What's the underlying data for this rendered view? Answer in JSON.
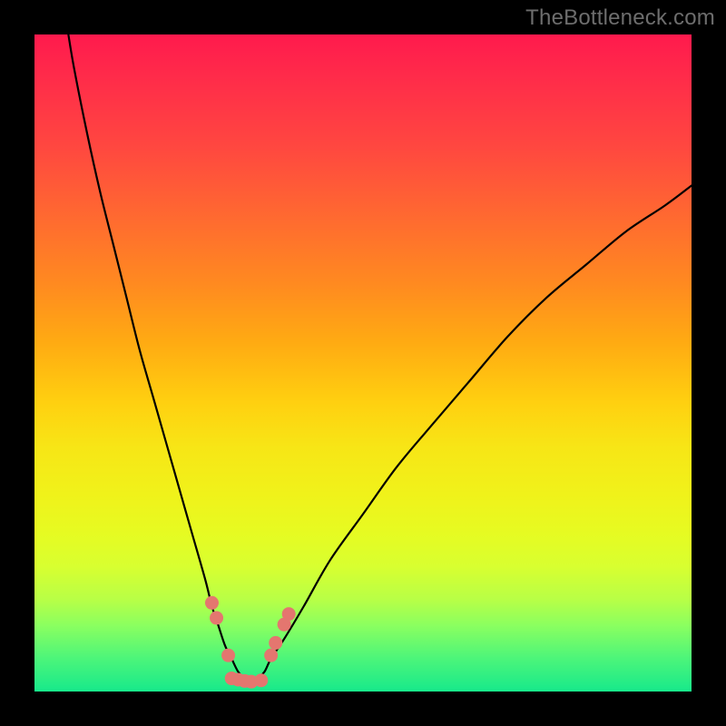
{
  "watermark": "TheBottleneck.com",
  "chart_data": {
    "type": "line",
    "title": "",
    "xlabel": "",
    "ylabel": "",
    "xlim": [
      0,
      100
    ],
    "ylim": [
      0,
      100
    ],
    "series": [
      {
        "name": "left-curve",
        "x": [
          5,
          6,
          8,
          10,
          12,
          14,
          16,
          18,
          20,
          22,
          24,
          26,
          27,
          28,
          29,
          30,
          31,
          32,
          33
        ],
        "values": [
          101,
          95,
          85,
          76,
          68,
          60,
          52,
          45,
          38,
          31,
          24,
          17,
          13,
          10,
          7,
          5,
          3,
          2,
          1
        ]
      },
      {
        "name": "right-curve",
        "x": [
          33,
          34,
          35,
          36,
          38,
          41,
          45,
          50,
          55,
          60,
          66,
          72,
          78,
          84,
          90,
          96,
          100
        ],
        "values": [
          1,
          2,
          3,
          5,
          8,
          13,
          20,
          27,
          34,
          40,
          47,
          54,
          60,
          65,
          70,
          74,
          77
        ]
      }
    ],
    "markers": [
      {
        "x": 27.0,
        "y": 13.5
      },
      {
        "x": 27.7,
        "y": 11.2
      },
      {
        "x": 29.5,
        "y": 5.5
      },
      {
        "x": 30.0,
        "y": 2.0
      },
      {
        "x": 31.0,
        "y": 1.8
      },
      {
        "x": 32.0,
        "y": 1.6
      },
      {
        "x": 33.0,
        "y": 1.5
      },
      {
        "x": 34.5,
        "y": 1.7
      },
      {
        "x": 36.0,
        "y": 5.5
      },
      {
        "x": 36.7,
        "y": 7.4
      },
      {
        "x": 38.0,
        "y": 10.2
      },
      {
        "x": 38.7,
        "y": 11.8
      }
    ],
    "grid": false,
    "legend": false
  }
}
